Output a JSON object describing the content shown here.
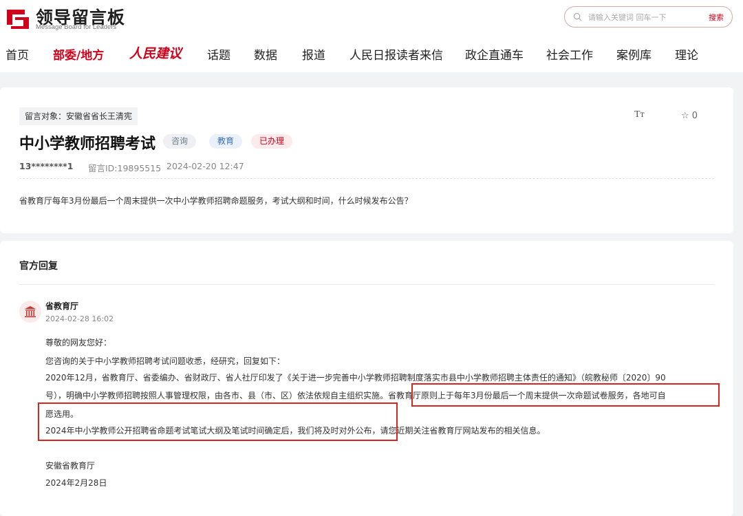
{
  "header": {
    "logo_title": "领导留言板",
    "logo_subtitle": "Message Board for Leaders",
    "search_placeholder": "请输入关键词 回车一下",
    "search_button": "搜索",
    "brand_color": "#d0021b"
  },
  "nav": {
    "items": [
      "首页",
      "部委/地方",
      "人民建议",
      "话题",
      "数据",
      "报道",
      "人民日报读者来信",
      "政企直通车",
      "社会工作",
      "案例库",
      "理论"
    ],
    "active_index": 1
  },
  "message": {
    "target": "留言对象：安徽省省长王清宪",
    "title": "中小学教师招聘考试",
    "tags": [
      "咨询",
      "教育",
      "已办理"
    ],
    "font_toggle": "Tт",
    "star_count": "0",
    "author": "13********1",
    "message_id": "留言ID:19895515",
    "date": "2024-02-20 12:47",
    "content": "省教育厅每年3月份最后一个周末提供一次中小学教师招聘命题服务，考试大纲和时间，什么时候发布公告？"
  },
  "reply": {
    "section_title": "官方回复",
    "org": "省教育厅",
    "date": "2024-02-28 16:02",
    "lines": [
      "尊敬的网友您好：",
      "您咨询的关于中小学教师招聘考试问题收悉，经研究，回复如下：",
      "2020年12月，省教育厅、省委编办、省财政厅、省人社厅印发了《关于进一步完善中小学教师招聘制度落实市县中小学教师招聘主体责任的通知》（皖教秘师〔2020〕90",
      "号），明确中小学教师招聘按照人事管理权限，由各市、县（市、区）依法依规自主组织实施。省教育厅原则上于每年3月份最后一个周末提供一次命题试卷服务，各地可自",
      "愿选用。",
      "2024年中小学教师公开招聘省命题考试笔试大纲及笔试时间确定后，我们将及时对外公布，请您近期关注省教育厅网站发布的相关信息。",
      "",
      "安徽省教育厅",
      "2024年2月28日"
    ]
  }
}
